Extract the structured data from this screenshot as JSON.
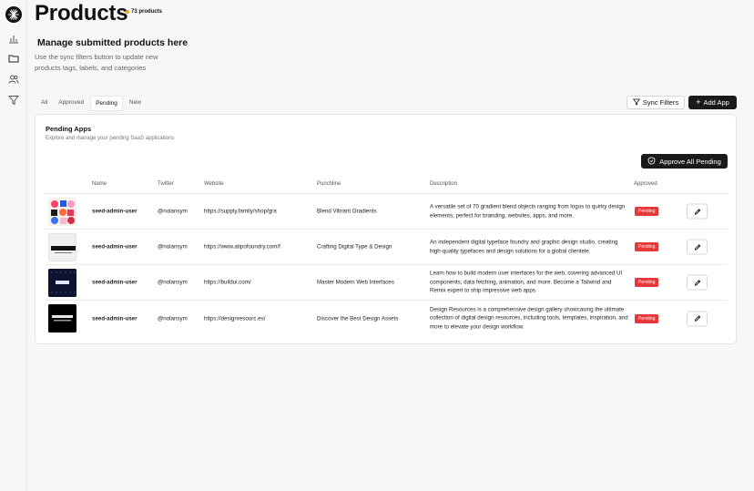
{
  "page": {
    "title": "Products",
    "count_label": "73 products",
    "heading": "Manage submitted products here",
    "description": "Use the sync filters button to update new products tags, labels, and categories"
  },
  "sidebar": {
    "icons": [
      "analytics-icon",
      "folder-icon",
      "users-icon",
      "filter-icon"
    ]
  },
  "tabs": [
    {
      "label": "All",
      "active": false
    },
    {
      "label": "Approved",
      "active": false
    },
    {
      "label": "Pending",
      "active": true
    },
    {
      "label": "New",
      "active": false
    }
  ],
  "toolbar": {
    "sync_label": "Sync Filters",
    "add_label": "Add App"
  },
  "card": {
    "title": "Pending Apps",
    "subtitle": "Explore and manage your pending SaaS applications",
    "approve_all_label": "Approve All Pending"
  },
  "table": {
    "columns": [
      "Name",
      "Twitter",
      "Website",
      "Punchline",
      "Description",
      "Approved"
    ],
    "rows": [
      {
        "name": "seed-admin-user",
        "twitter": "@nolansym",
        "website": "https://supply.family/shop/gra",
        "punchline": "Blend Vibrant Gradients",
        "description": "A versatile set of 70 gradient blend objects ranging from logos to quirky design elements, perfect for branding, websites, apps, and more.",
        "status": "Pending"
      },
      {
        "name": "seed-admin-user",
        "twitter": "@nolansym",
        "website": "https://www.atipofoundry.com/f",
        "punchline": "Crafting Digital Type & Design",
        "description": "An independent digital typeface foundry and graphic design studio, creating high-quality typefaces and design solutions for a global clientele.",
        "status": "Pending"
      },
      {
        "name": "seed-admin-user",
        "twitter": "@nolansym",
        "website": "https://buildui.com/",
        "punchline": "Master Modern Web Interfaces",
        "description": "Learn how to build modern user interfaces for the web, covering advanced UI components, data fetching, animation, and more. Become a Tailwind and Remix expert to ship impressive web apps.",
        "status": "Pending"
      },
      {
        "name": "seed-admin-user",
        "twitter": "@nolansym",
        "website": "https://designresourc.es/",
        "punchline": "Discover the Best Design Assets",
        "description": "Design Resources is a comprehensive design gallery showcasing the ultimate collection of digital design resources, including tools, templates, inspiration, and more to elevate your design workflow.",
        "status": "Pending"
      }
    ]
  },
  "colors": {
    "primary": "#1a1a1a",
    "pending": "#e5393b",
    "badge_dot": "#e8a417"
  }
}
